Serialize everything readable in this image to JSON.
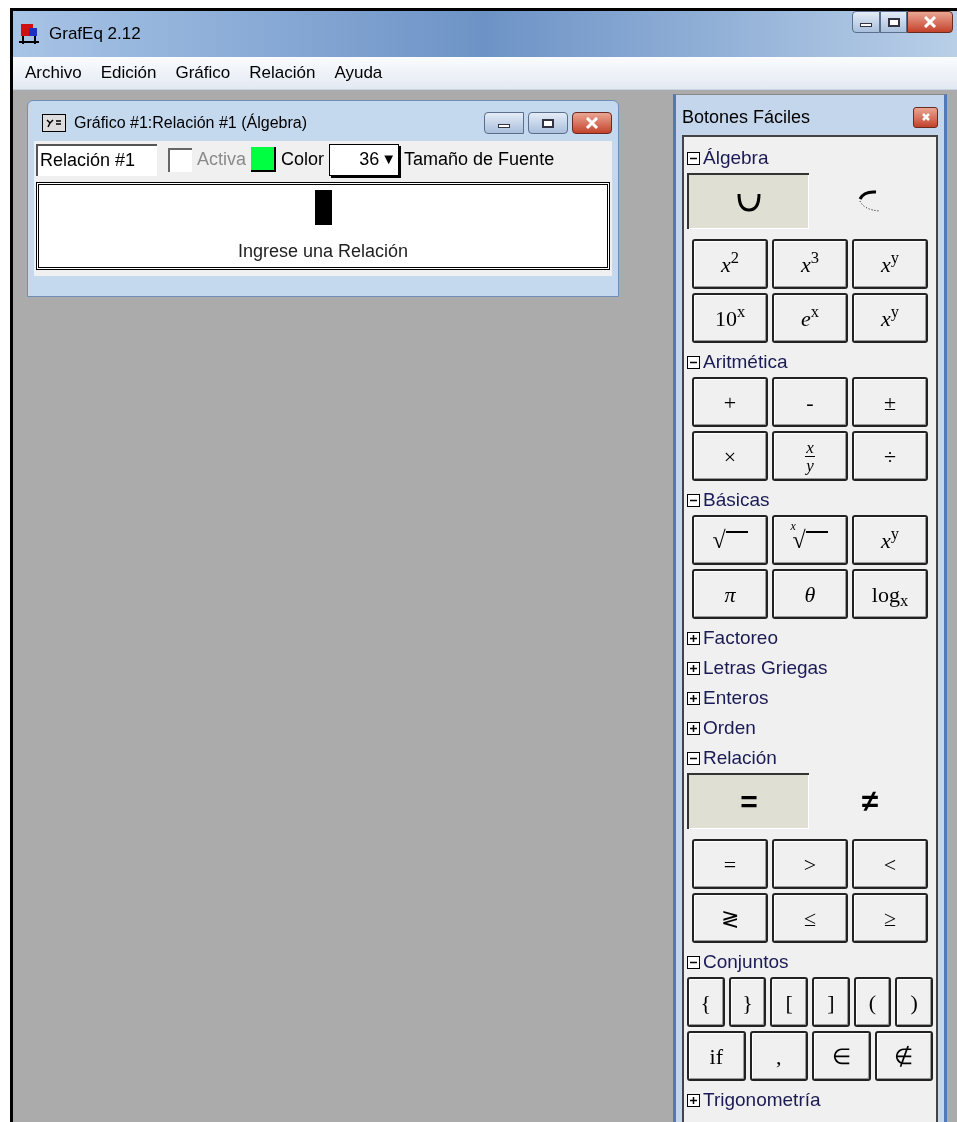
{
  "app": {
    "title": "GrafEq 2.12"
  },
  "menu": [
    "Archivo",
    "Edición",
    "Gráfico",
    "Relación",
    "Ayuda"
  ],
  "graph_window": {
    "title": "Gráfico #1:Relación #1 (Álgebra)",
    "name_field": {
      "value": "Relación #1"
    },
    "active": {
      "label": "Activa",
      "checked": false,
      "disabled": true
    },
    "color": {
      "label": "Color",
      "color": "#00ff40"
    },
    "font_size": {
      "value": "36",
      "arrow": "▼",
      "label": "Tamaño de Fuente"
    },
    "editor": {
      "placeholder": "Ingrese una Relación"
    }
  },
  "palette": {
    "title": "Botones Fáciles",
    "sections": [
      {
        "label": "Álgebra",
        "expanded": true,
        "toggles": [
          {
            "kind": "parabola",
            "selected": true
          },
          {
            "kind": "arc",
            "selected": false
          }
        ],
        "rows": [
          [
            {
              "kind": "text",
              "label": "*x*$^{2}$"
            },
            {
              "kind": "text",
              "label": "*x*$^{3}$"
            },
            {
              "kind": "text",
              "label": "*x*$^{y}$"
            }
          ],
          [
            {
              "kind": "text",
              "label": "10$^{x}$"
            },
            {
              "kind": "text",
              "label": "*e*$^{x}$"
            },
            {
              "kind": "text",
              "label": "*x*$^{y}$"
            }
          ]
        ]
      },
      {
        "label": "Aritmética",
        "expanded": true,
        "rows": [
          [
            {
              "kind": "text",
              "label": "+"
            },
            {
              "kind": "text",
              "label": "-"
            },
            {
              "kind": "text",
              "label": "±"
            }
          ],
          [
            {
              "kind": "text",
              "label": "×"
            },
            {
              "kind": "fraction",
              "numerator": "x",
              "denominator": "y"
            },
            {
              "kind": "text",
              "label": "÷"
            }
          ]
        ]
      },
      {
        "label": "Básicas",
        "expanded": true,
        "rows": [
          [
            {
              "kind": "root",
              "symbol": "√"
            },
            {
              "kind": "root",
              "symbol": "√",
              "index": "x"
            },
            {
              "kind": "text",
              "label": "*x*$^{y}$"
            }
          ],
          [
            {
              "kind": "text",
              "label": "*π*"
            },
            {
              "kind": "text",
              "label": "*θ*"
            },
            {
              "kind": "text",
              "label": "log$_{x}$"
            }
          ]
        ]
      },
      {
        "label": "Factoreo",
        "expanded": false
      },
      {
        "label": "Letras Griegas",
        "expanded": false
      },
      {
        "label": "Enteros",
        "expanded": false
      },
      {
        "label": "Orden",
        "expanded": false
      },
      {
        "label": "Relación",
        "expanded": true,
        "toggles": [
          {
            "kind": "text",
            "label": "=",
            "selected": true
          },
          {
            "kind": "text",
            "label": "≠",
            "selected": false
          }
        ],
        "rows": [
          [
            {
              "kind": "text",
              "label": "="
            },
            {
              "kind": "text",
              "label": ">"
            },
            {
              "kind": "text",
              "label": "<"
            }
          ],
          [
            {
              "kind": "text",
              "label": "≷"
            },
            {
              "kind": "text",
              "label": "≤"
            },
            {
              "kind": "text",
              "label": "≥"
            }
          ]
        ]
      },
      {
        "label": "Conjuntos",
        "expanded": true,
        "rows": [
          [
            {
              "kind": "text",
              "label": "{"
            },
            {
              "kind": "text",
              "label": "}"
            },
            {
              "kind": "text",
              "label": "["
            },
            {
              "kind": "text",
              "label": "]"
            },
            {
              "kind": "text",
              "label": "("
            },
            {
              "kind": "text",
              "label": ")"
            }
          ],
          [
            {
              "kind": "text",
              "label": "if"
            },
            {
              "kind": "text",
              "label": ","
            },
            {
              "kind": "text",
              "label": "∈"
            },
            {
              "kind": "text",
              "label": "∉"
            }
          ]
        ]
      },
      {
        "label": "Trigonometría",
        "expanded": false
      }
    ]
  }
}
